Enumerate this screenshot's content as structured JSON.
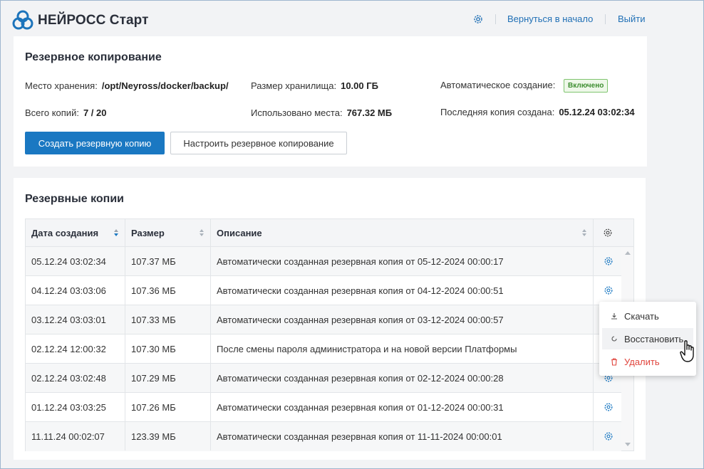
{
  "header": {
    "title": "НЕЙРОСС Старт",
    "home_link": "Вернуться в начало",
    "logout_link": "Выйти"
  },
  "backup": {
    "title": "Резервное копирование",
    "storage_location_label": "Место хранения:",
    "storage_location_value": "/opt/Neyross/docker/backup/",
    "storage_size_label": "Размер хранилища:",
    "storage_size_value": "10.00 ГБ",
    "auto_create_label": "Автоматическое создание:",
    "auto_create_status": "Включено",
    "total_copies_label": "Всего копий:",
    "total_copies_value": "7 / 20",
    "used_space_label": "Использовано места:",
    "used_space_value": "767.32 МБ",
    "last_copy_label": "Последняя копия создана:",
    "last_copy_value": "05.12.24 03:02:34",
    "create_button": "Создать резервную копию",
    "configure_button": "Настроить резервное копирование"
  },
  "copies": {
    "title": "Резервные копии",
    "columns": [
      "Дата создания",
      "Размер",
      "Описание"
    ],
    "rows": [
      {
        "date": "05.12.24 03:02:34",
        "size": "107.37 МБ",
        "desc": "Автоматически созданная резервная копия от 05-12-2024 00:00:17"
      },
      {
        "date": "04.12.24 03:03:06",
        "size": "107.36 МБ",
        "desc": "Автоматически созданная резервная копия от 04-12-2024 00:00:51"
      },
      {
        "date": "03.12.24 03:03:01",
        "size": "107.33 МБ",
        "desc": "Автоматически созданная резервная копия от 03-12-2024 00:00:57"
      },
      {
        "date": "02.12.24 12:00:32",
        "size": "107.30 МБ",
        "desc": "После смены пароля администратора и на новой версии Платформы"
      },
      {
        "date": "02.12.24 03:02:48",
        "size": "107.29 МБ",
        "desc": "Автоматически созданная резервная копия от 02-12-2024 00:00:28"
      },
      {
        "date": "01.12.24 03:03:25",
        "size": "107.26 МБ",
        "desc": "Автоматически созданная резервная копия от 01-12-2024 00:00:31"
      },
      {
        "date": "11.11.24 00:02:07",
        "size": "123.39 МБ",
        "desc": "Автоматически созданная резервная копия от 11-11-2024 00:00:01"
      }
    ]
  },
  "menu": {
    "download": "Скачать",
    "restore": "Восстановить",
    "delete": "Удалить"
  },
  "colors": {
    "accent": "#1a78c2",
    "link": "#1f6fb5",
    "success": "#3c8d2f",
    "danger": "#e0443c"
  }
}
